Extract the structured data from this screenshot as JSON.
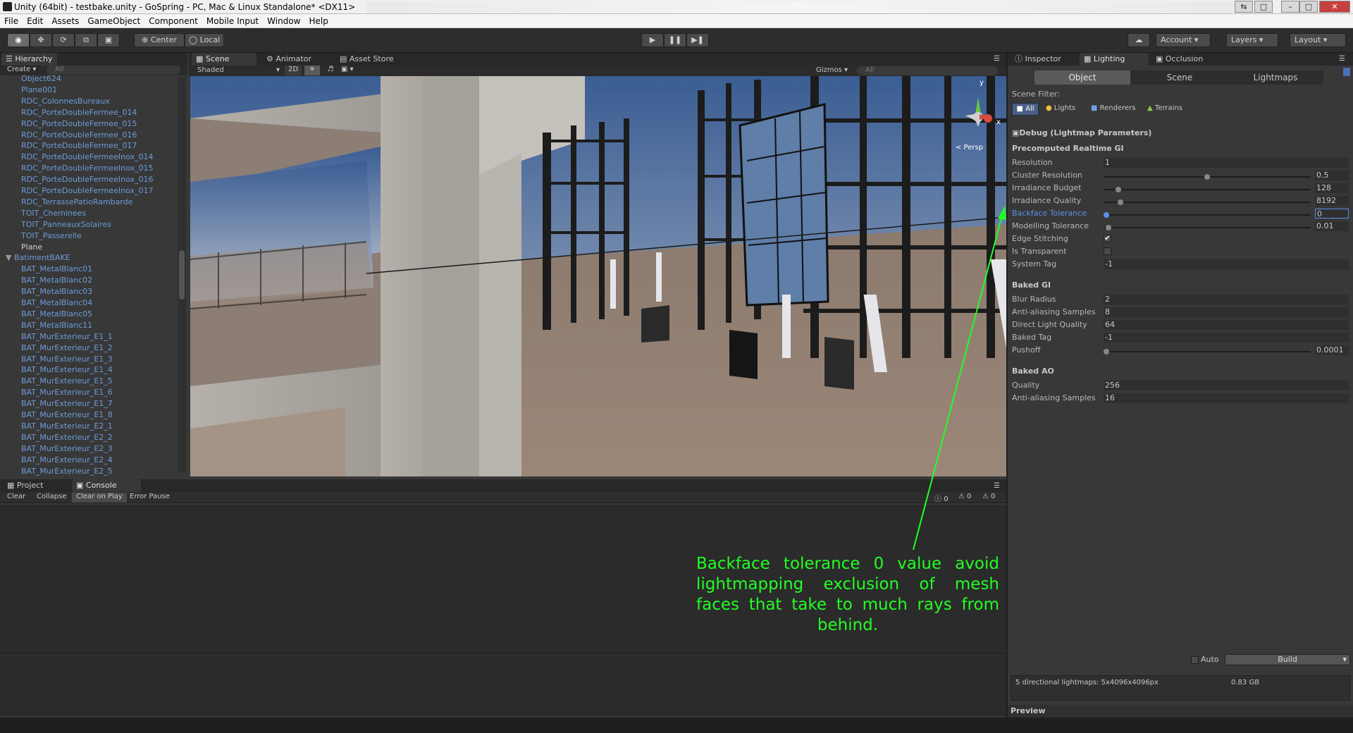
{
  "window": {
    "title": "Unity (64bit) - testbake.unity - GoSpring - PC, Mac & Linux Standalone* <DX11>"
  },
  "menu": [
    "File",
    "Edit",
    "Assets",
    "GameObject",
    "Component",
    "Mobile Input",
    "Window",
    "Help"
  ],
  "toolbar": {
    "center_label": "Center",
    "local_label": "Local",
    "account_label": "Account",
    "layers_label": "Layers",
    "layout_label": "Layout"
  },
  "hierarchy": {
    "tab": "Hierarchy",
    "create": "Create",
    "search_placeholder": "All",
    "items": [
      {
        "label": "Object624",
        "type": "blue"
      },
      {
        "label": "Plane001",
        "type": "blue"
      },
      {
        "label": "RDC_ColonnesBureaux",
        "type": "blue"
      },
      {
        "label": "RDC_PorteDoubleFermee_014",
        "type": "blue"
      },
      {
        "label": "RDC_PorteDoubleFermee_015",
        "type": "blue"
      },
      {
        "label": "RDC_PorteDoubleFermee_016",
        "type": "blue"
      },
      {
        "label": "RDC_PorteDoubleFermee_017",
        "type": "blue"
      },
      {
        "label": "RDC_PorteDoubleFermeeInox_014",
        "type": "blue"
      },
      {
        "label": "RDC_PorteDoubleFermeeInox_015",
        "type": "blue"
      },
      {
        "label": "RDC_PorteDoubleFermeeInox_016",
        "type": "blue"
      },
      {
        "label": "RDC_PorteDoubleFermeeInox_017",
        "type": "blue"
      },
      {
        "label": "RDC_TerrassePatioRambarde",
        "type": "blue"
      },
      {
        "label": "TOIT_Cheminees",
        "type": "blue"
      },
      {
        "label": "TOIT_PanneauxSolaires",
        "type": "blue"
      },
      {
        "label": "TOIT_Passerelle",
        "type": "blue"
      },
      {
        "label": "Plane",
        "type": "white"
      },
      {
        "label": "BatimentBAKE",
        "type": "group"
      },
      {
        "label": "BAT_MetalBlanc01",
        "type": "blue"
      },
      {
        "label": "BAT_MetalBlanc02",
        "type": "blue"
      },
      {
        "label": "BAT_MetalBlanc03",
        "type": "blue"
      },
      {
        "label": "BAT_MetalBlanc04",
        "type": "blue"
      },
      {
        "label": "BAT_MetalBlanc05",
        "type": "blue"
      },
      {
        "label": "BAT_MetalBlanc11",
        "type": "blue"
      },
      {
        "label": "BAT_MurExterieur_E1_1",
        "type": "blue"
      },
      {
        "label": "BAT_MurExterieur_E1_2",
        "type": "blue"
      },
      {
        "label": "BAT_MurExterieur_E1_3",
        "type": "blue"
      },
      {
        "label": "BAT_MurExterieur_E1_4",
        "type": "blue"
      },
      {
        "label": "BAT_MurExterieur_E1_5",
        "type": "blue"
      },
      {
        "label": "BAT_MurExterieur_E1_6",
        "type": "blue"
      },
      {
        "label": "BAT_MurExterieur_E1_7",
        "type": "blue"
      },
      {
        "label": "BAT_MurExterieur_E1_8",
        "type": "blue"
      },
      {
        "label": "BAT_MurExterieur_E2_1",
        "type": "blue"
      },
      {
        "label": "BAT_MurExterieur_E2_2",
        "type": "blue"
      },
      {
        "label": "BAT_MurExterieur_E2_3",
        "type": "blue"
      },
      {
        "label": "BAT_MurExterieur_E2_4",
        "type": "blue"
      },
      {
        "label": "BAT_MurExterieur_E2_5",
        "type": "blue"
      }
    ]
  },
  "scene_tabs": {
    "scene": "Scene",
    "animator": "Animator",
    "asset_store": "Asset Store"
  },
  "scene_toolbar": {
    "shading": "Shaded",
    "mode2d": "2D",
    "gizmos": "Gizmos",
    "search_placeholder": "All",
    "persp": "< Persp",
    "axis_y": "y",
    "axis_x": "x"
  },
  "bottom_tabs": {
    "project": "Project",
    "console": "Console"
  },
  "console": {
    "clear": "Clear",
    "collapse": "Collapse",
    "clear_on_play": "Clear on Play",
    "error_pause": "Error Pause",
    "count_logs": "0",
    "count_warnings": "0",
    "count_errors": "0"
  },
  "inspector": {
    "tab_inspector": "Inspector",
    "tab_lighting": "Lighting",
    "tab_occlusion": "Occlusion",
    "subtabs": [
      "Object",
      "Scene",
      "Lightmaps"
    ],
    "scene_filter_label": "Scene Filter:",
    "filters": [
      "All",
      "Lights",
      "Renderers",
      "Terrains"
    ],
    "debug_header": "Debug (Lightmap Parameters)",
    "precomputed_header": "Precomputed Realtime GI",
    "resolution": {
      "label": "Resolution",
      "value": "1"
    },
    "cluster_resolution": {
      "label": "Cluster Resolution",
      "value": "0.5",
      "level": 0.5
    },
    "irradiance_budget": {
      "label": "Irradiance Budget",
      "value": "128",
      "level": 0.06
    },
    "irradiance_quality": {
      "label": "Irradiance Quality",
      "value": "8192",
      "level": 0.07
    },
    "backface_tolerance": {
      "label": "Backface Tolerance",
      "value": "0",
      "level": 0
    },
    "modelling_tolerance": {
      "label": "Modelling Tolerance",
      "value": "0.01",
      "level": 0.01
    },
    "edge_stitching": {
      "label": "Edge Stitching",
      "checked": true
    },
    "is_transparent": {
      "label": "Is Transparent",
      "checked": false
    },
    "system_tag": {
      "label": "System Tag",
      "value": "-1"
    },
    "baked_gi_header": "Baked GI",
    "blur_radius": {
      "label": "Blur Radius",
      "value": "2"
    },
    "aa_samples": {
      "label": "Anti-aliasing Samples",
      "value": "8"
    },
    "direct_light_quality": {
      "label": "Direct Light Quality",
      "value": "64"
    },
    "baked_tag": {
      "label": "Baked Tag",
      "value": "-1"
    },
    "pushoff": {
      "label": "Pushoff",
      "value": "0.0001",
      "level": 0
    },
    "baked_ao_header": "Baked AO",
    "ao_quality": {
      "label": "Quality",
      "value": "256"
    },
    "ao_aa_samples": {
      "label": "Anti-aliasing Samples",
      "value": "16"
    },
    "auto_label": "Auto",
    "build_label": "Build",
    "lightmap_summary": "5 directional lightmaps: 5x4096x4096px",
    "lightmap_size": "0.83 GB",
    "preview_label": "Preview"
  },
  "annotation": "Backface tolerance 0 value avoid lightmapping exclusion of mesh faces that take to much rays from behind.",
  "colors": {
    "annotation": "#22ff22",
    "hierarchy_prefab": "#6d9bd8",
    "highlight_label": "#5b8fe8"
  }
}
